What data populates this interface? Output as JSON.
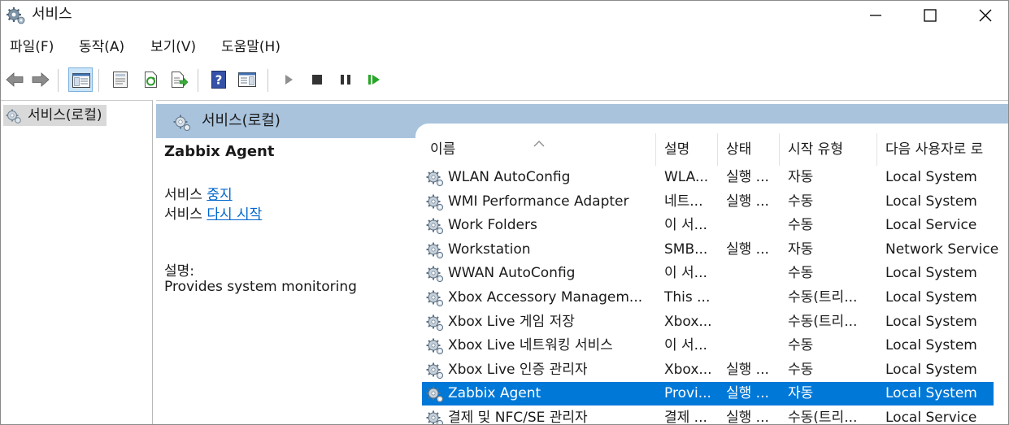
{
  "window": {
    "title": "서비스",
    "controls": {
      "minimize": "minimize",
      "maximize": "maximize",
      "close": "close"
    }
  },
  "menu": [
    "파일(F)",
    "동작(A)",
    "보기(V)",
    "도움말(H)"
  ],
  "tree": {
    "root_label": "서비스(로컬)"
  },
  "pane_header": {
    "title": "서비스(로컬)"
  },
  "details": {
    "service_name": "Zabbix Agent",
    "stop_prefix": "서비스",
    "stop_link": "중지",
    "restart_prefix": "서비스",
    "restart_link": "다시 시작",
    "description_label": "설명:",
    "description_text": "Provides system monitoring"
  },
  "list": {
    "columns": [
      "이름",
      "설명",
      "상태",
      "시작 유형",
      "다음 사용자로 로"
    ],
    "sort_indicator": "^",
    "rows": [
      {
        "name": "WLAN AutoConfig",
        "desc": "WLA...",
        "state": "실행 ...",
        "start": "자동",
        "logon": "Local System"
      },
      {
        "name": "WMI Performance Adapter",
        "desc": "네트...",
        "state": "실행 ...",
        "start": "수동",
        "logon": "Local System"
      },
      {
        "name": "Work Folders",
        "desc": "이 서...",
        "state": "",
        "start": "수동",
        "logon": "Local Service"
      },
      {
        "name": "Workstation",
        "desc": "SMB...",
        "state": "실행 ...",
        "start": "자동",
        "logon": "Network Service"
      },
      {
        "name": "WWAN AutoConfig",
        "desc": "이 서...",
        "state": "",
        "start": "수동",
        "logon": "Local System"
      },
      {
        "name": "Xbox Accessory Managem...",
        "desc": "This ...",
        "state": "",
        "start": "수동(트리...",
        "logon": "Local System"
      },
      {
        "name": "Xbox Live 게임 저장",
        "desc": "Xbox...",
        "state": "",
        "start": "수동(트리...",
        "logon": "Local System"
      },
      {
        "name": "Xbox Live 네트워킹 서비스",
        "desc": "이 서...",
        "state": "",
        "start": "수동",
        "logon": "Local System"
      },
      {
        "name": "Xbox Live 인증 관리자",
        "desc": "Xbox...",
        "state": "실행 ...",
        "start": "수동",
        "logon": "Local System"
      },
      {
        "name": "Zabbix Agent",
        "desc": "Provi...",
        "state": "실행 ...",
        "start": "자동",
        "logon": "Local System",
        "selected": true
      },
      {
        "name": "결제 및 NFC/SE 관리자",
        "desc": "결제 ...",
        "state": "실행 ...",
        "start": "수동(트리...",
        "logon": "Local Service"
      }
    ]
  },
  "colors": {
    "accent": "#0078d7",
    "header_band": "#a9c3dd",
    "link": "#0066cc"
  }
}
